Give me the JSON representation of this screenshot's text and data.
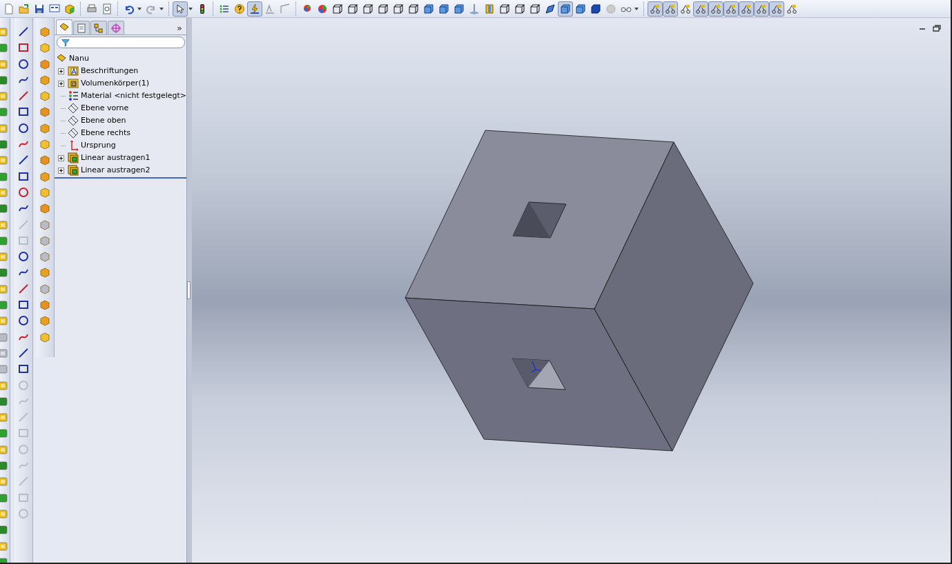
{
  "toolbar_groups": [
    [
      {
        "kind": "new",
        "pressed": false
      },
      {
        "kind": "open",
        "pressed": false
      },
      {
        "kind": "save",
        "pressed": false
      },
      {
        "kind": "properties",
        "pressed": false
      },
      {
        "kind": "rebuild",
        "pressed": false
      }
    ],
    [
      {
        "kind": "print",
        "pressed": false
      },
      {
        "kind": "preview",
        "pressed": false
      }
    ],
    [
      {
        "kind": "undo",
        "pressed": false
      },
      {
        "kind": "redo",
        "pressed": false
      }
    ],
    [
      {
        "kind": "select",
        "pressed": true
      },
      {
        "kind": "light",
        "pressed": false
      }
    ],
    [
      {
        "kind": "list",
        "pressed": false
      },
      {
        "kind": "help",
        "pressed": false
      },
      {
        "kind": "bolt",
        "pressed": true
      },
      {
        "kind": "sketchgrey",
        "pressed": false
      },
      {
        "kind": "sketchgrey2",
        "pressed": false
      }
    ],
    [
      {
        "kind": "ball",
        "pressed": false
      },
      {
        "kind": "ball2",
        "pressed": false
      },
      {
        "kind": "wirecube",
        "pressed": false
      },
      {
        "kind": "wirecube",
        "pressed": false
      },
      {
        "kind": "wirecube",
        "pressed": false
      },
      {
        "kind": "wirecube",
        "pressed": false
      },
      {
        "kind": "wirecube",
        "pressed": false
      },
      {
        "kind": "wirecube",
        "pressed": false
      },
      {
        "kind": "bluecube",
        "pressed": false
      },
      {
        "kind": "bluecube",
        "pressed": false
      },
      {
        "kind": "bluecube",
        "pressed": false
      },
      {
        "kind": "axis",
        "pressed": false
      },
      {
        "kind": "section",
        "pressed": false
      },
      {
        "kind": "wirecube",
        "pressed": false
      },
      {
        "kind": "wirecube",
        "pressed": false
      },
      {
        "kind": "wirecube",
        "pressed": false
      },
      {
        "kind": "slant",
        "pressed": false
      },
      {
        "kind": "bluecube",
        "pressed": true
      },
      {
        "kind": "bluecube",
        "pressed": false
      },
      {
        "kind": "darkcube",
        "pressed": false
      },
      {
        "kind": "greyball",
        "pressed": false
      },
      {
        "kind": "glasses",
        "pressed": false
      }
    ],
    [
      {
        "kind": "relation",
        "pressed": true
      },
      {
        "kind": "relation",
        "pressed": true
      },
      {
        "kind": "relation",
        "pressed": false
      },
      {
        "kind": "relation",
        "pressed": true
      },
      {
        "kind": "relation",
        "pressed": true
      },
      {
        "kind": "relation",
        "pressed": true
      },
      {
        "kind": "relation",
        "pressed": true
      },
      {
        "kind": "relation",
        "pressed": true
      },
      {
        "kind": "relation",
        "pressed": true
      },
      {
        "kind": "relation",
        "pressed": false
      }
    ]
  ],
  "feature_tabs": [
    {
      "selected": true
    },
    {
      "selected": false
    },
    {
      "selected": false
    },
    {
      "selected": false
    }
  ],
  "tabs_overflow": "»",
  "tree": {
    "root": "Nanu",
    "items": [
      {
        "label": "Beschriftungen",
        "kind": "annotations",
        "expandable": true
      },
      {
        "label": "Volumenkörper(1)",
        "kind": "solids",
        "expandable": true
      },
      {
        "label": "Material <nicht festgelegt>",
        "kind": "material",
        "expandable": false
      },
      {
        "label": "Ebene vorne",
        "kind": "plane",
        "expandable": false
      },
      {
        "label": "Ebene oben",
        "kind": "plane",
        "expandable": false
      },
      {
        "label": "Ebene rechts",
        "kind": "plane",
        "expandable": false
      },
      {
        "label": "Ursprung",
        "kind": "origin",
        "expandable": false
      },
      {
        "label": "Linear austragen1",
        "kind": "extrude",
        "expandable": true
      },
      {
        "label": "Linear austragen2",
        "kind": "extrude",
        "expandable": true
      }
    ]
  }
}
